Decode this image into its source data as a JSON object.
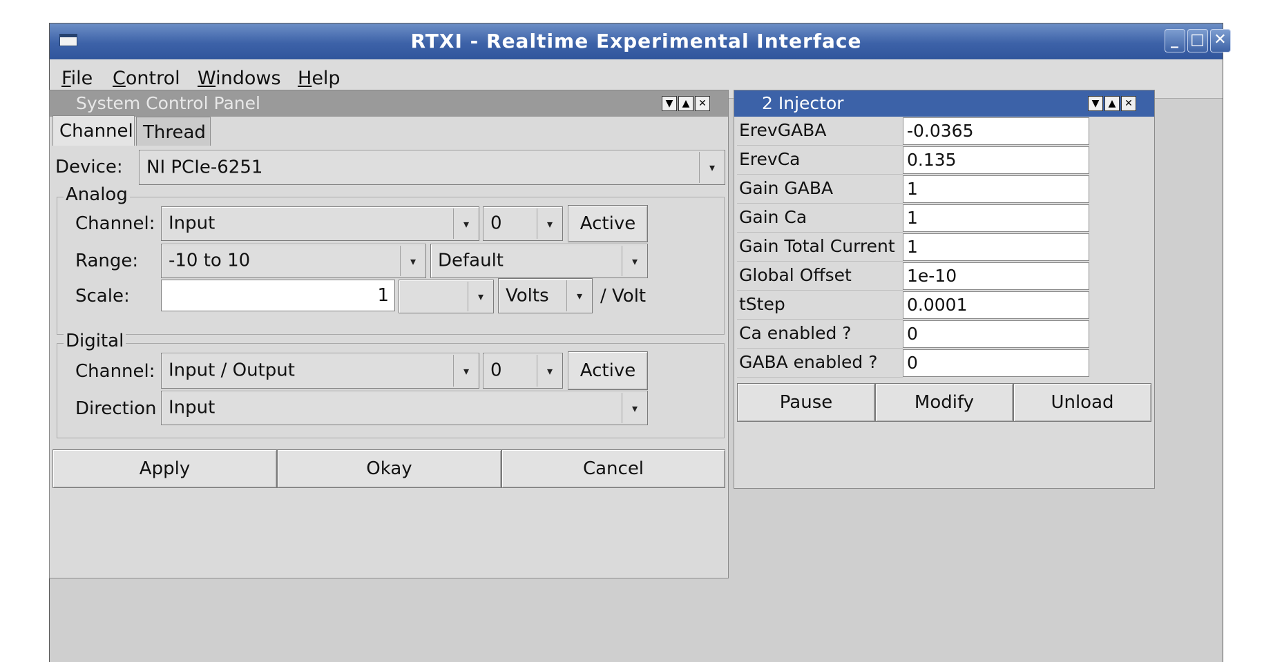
{
  "window": {
    "title": "RTXI - Realtime Experimental Interface",
    "controls": [
      "_",
      "□",
      "✕"
    ]
  },
  "menubar": {
    "items": [
      {
        "accel": "F",
        "rest": "ile"
      },
      {
        "accel": "C",
        "rest": "ontrol"
      },
      {
        "accel": "W",
        "rest": "indows"
      },
      {
        "accel": "H",
        "rest": "elp"
      }
    ]
  },
  "system_panel": {
    "title": "System Control Panel",
    "tabs": [
      "Channel",
      "Thread"
    ],
    "device_label": "Device:",
    "device_value": "NI PCIe-6251",
    "analog": {
      "legend": "Analog",
      "channel_label": "Channel:",
      "channel_type": "Input",
      "channel_number": "0",
      "active_label": "Active",
      "range_label": "Range:",
      "range_value": "-10 to 10",
      "reference_value": "Default",
      "scale_label": "Scale:",
      "scale_value": "1",
      "scale_prefix": "",
      "scale_units": "Volts",
      "scale_suffix": "/ Volt"
    },
    "digital": {
      "legend": "Digital",
      "channel_label": "Channel:",
      "channel_type": "Input / Output",
      "channel_number": "0",
      "active_label": "Active",
      "direction_label": "Direction",
      "direction_value": "Input"
    },
    "buttons": {
      "apply": "Apply",
      "okay": "Okay",
      "cancel": "Cancel"
    }
  },
  "injector": {
    "title": "2 Injector",
    "params": [
      {
        "name": "ErevGABA",
        "value": "-0.0365"
      },
      {
        "name": "ErevCa",
        "value": "0.135"
      },
      {
        "name": "Gain GABA",
        "value": "1"
      },
      {
        "name": "Gain Ca",
        "value": "1"
      },
      {
        "name": "Gain Total Current",
        "value": "1"
      },
      {
        "name": "Global Offset",
        "value": "1e-10"
      },
      {
        "name": "tStep",
        "value": "0.0001"
      },
      {
        "name": "Ca enabled ?",
        "value": "0"
      },
      {
        "name": "GABA enabled ?",
        "value": "0"
      }
    ],
    "buttons": {
      "pause": "Pause",
      "modify": "Modify",
      "unload": "Unload"
    }
  },
  "colors": {
    "titlebar": "#3d62a8",
    "active_subwindow_title": "#3c62a8",
    "inactive_subwindow_title": "#9a9a9a",
    "mdi_background": "#cfcfcf"
  }
}
